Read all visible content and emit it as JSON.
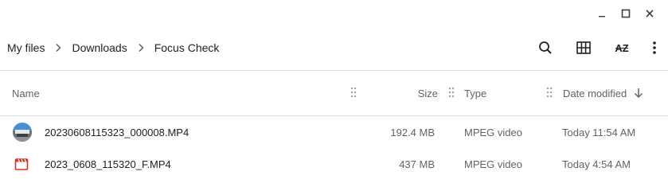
{
  "window": {
    "controls": {
      "minimize_icon": "minimize-icon",
      "maximize_icon": "maximize-icon",
      "close_icon": "close-icon"
    }
  },
  "breadcrumb": {
    "items": [
      "My files",
      "Downloads",
      "Focus Check"
    ]
  },
  "toolbar": {
    "search_icon": "search-icon",
    "grid_view_icon": "grid-view-icon",
    "sort_icon": "sort-az-icon",
    "sort_label": "AZ",
    "more_icon": "more-vertical-icon"
  },
  "columns": {
    "name": "Name",
    "size": "Size",
    "type": "Type",
    "date_modified": "Date modified",
    "sort_direction_icon": "arrow-down-icon"
  },
  "files": [
    {
      "icon": "video-thumbnail",
      "name": "20230608115323_000008.MP4",
      "size": "192.4 MB",
      "type": "MPEG video",
      "date": "Today 11:54 AM"
    },
    {
      "icon": "video-file-icon",
      "name": "2023_0608_115320_F.MP4",
      "size": "437 MB",
      "type": "MPEG video",
      "date": "Today 4:54 AM"
    }
  ],
  "colors": {
    "accent_video": "#d93025",
    "divider": "#dadce0",
    "text_secondary": "#5f6368"
  }
}
